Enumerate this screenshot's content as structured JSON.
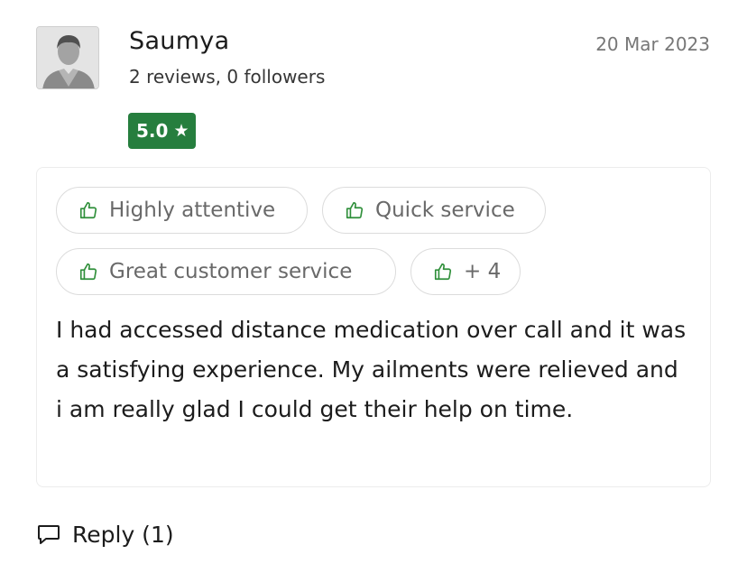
{
  "review": {
    "author": {
      "name": "Saumya",
      "stats": "2 reviews, 0 followers",
      "avatar_icon": "user-silhouette-icon"
    },
    "date": "20 Mar 2023",
    "rating": {
      "value": "5.0",
      "star": "★",
      "color": "#267e3e"
    },
    "tags": [
      {
        "label": "Highly attentive",
        "icon": "thumbs-up-icon"
      },
      {
        "label": "Quick service",
        "icon": "thumbs-up-icon"
      },
      {
        "label": "Great customer service",
        "icon": "thumbs-up-icon"
      },
      {
        "label": "+ 4",
        "icon": "thumbs-up-icon"
      }
    ],
    "text": "I had accessed distance medication over call and it was a satisfying experience. My ailments were relieved and i am really glad I could get their help on time.",
    "reply": {
      "label": "Reply (1)",
      "icon": "speech-bubble-icon"
    }
  },
  "colors": {
    "accent_green": "#267e3e",
    "thumb_green": "#2f8f3a"
  }
}
